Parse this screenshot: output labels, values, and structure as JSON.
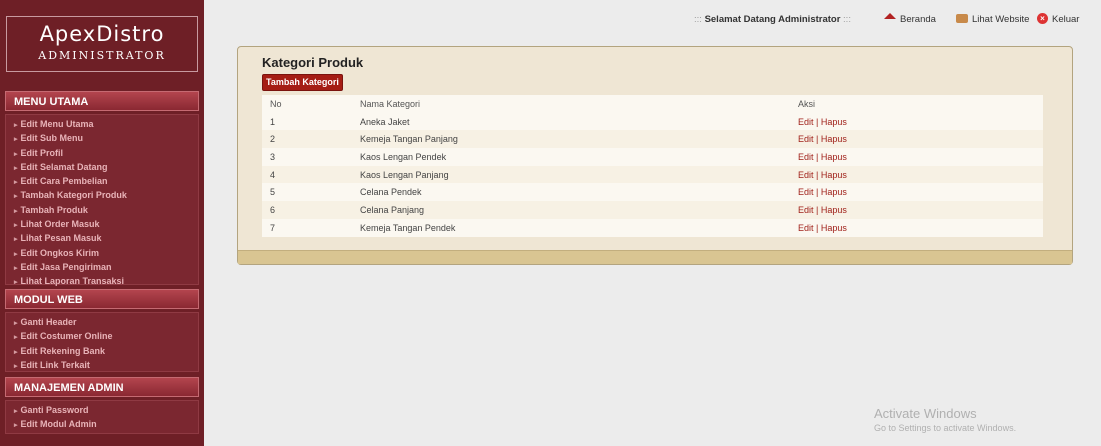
{
  "logo": {
    "title": "ApexDistro",
    "subtitle": "ADMINISTRATOR"
  },
  "topbar": {
    "welcome_prefix": ":::",
    "welcome": "Selamat Datang Administrator",
    "welcome_suffix": ":::",
    "links": [
      {
        "label": "Beranda",
        "icon": "home-icon"
      },
      {
        "label": "Lihat Website",
        "icon": "website-icon"
      },
      {
        "label": "Keluar",
        "icon": "logout-icon"
      }
    ]
  },
  "sidebar": {
    "sections": [
      {
        "title": "MENU UTAMA",
        "items": [
          "Edit Menu Utama",
          "Edit Sub Menu",
          "Edit Profil",
          "Edit Selamat Datang",
          "Edit Cara Pembelian",
          "Tambah Kategori Produk",
          "Tambah Produk",
          "Lihat Order Masuk",
          "Lihat Pesan Masuk",
          "Edit Ongkos Kirim",
          "Edit Jasa Pengiriman",
          "Lihat Laporan Transaksi"
        ]
      },
      {
        "title": "MODUL WEB",
        "items": [
          "Ganti Header",
          "Edit Costumer Online",
          "Edit Rekening Bank",
          "Edit Link Terkait"
        ]
      },
      {
        "title": "MANAJEMEN ADMIN",
        "items": [
          "Ganti Password",
          "Edit Modul Admin"
        ]
      }
    ]
  },
  "main": {
    "title": "Kategori Produk",
    "add_button": "Tambah Kategori",
    "table": {
      "headers": [
        "No",
        "Nama Kategori",
        "Aksi"
      ],
      "rows": [
        {
          "no": "1",
          "name": "Aneka Jaket"
        },
        {
          "no": "2",
          "name": "Kemeja Tangan Panjang"
        },
        {
          "no": "3",
          "name": "Kaos Lengan Pendek"
        },
        {
          "no": "4",
          "name": "Kaos Lengan Panjang"
        },
        {
          "no": "5",
          "name": "Celana Pendek"
        },
        {
          "no": "6",
          "name": "Celana Panjang"
        },
        {
          "no": "7",
          "name": "Kemeja Tangan Pendek"
        }
      ],
      "edit_label": "Edit",
      "separator": "|",
      "delete_label": "Hapus"
    }
  },
  "watermark": {
    "line1": "Activate Windows",
    "line2": "Go to Settings to activate Windows."
  },
  "colors": {
    "sidebar": "#6e1f26",
    "accent": "#a0211a",
    "panel": "#efe6d4"
  }
}
